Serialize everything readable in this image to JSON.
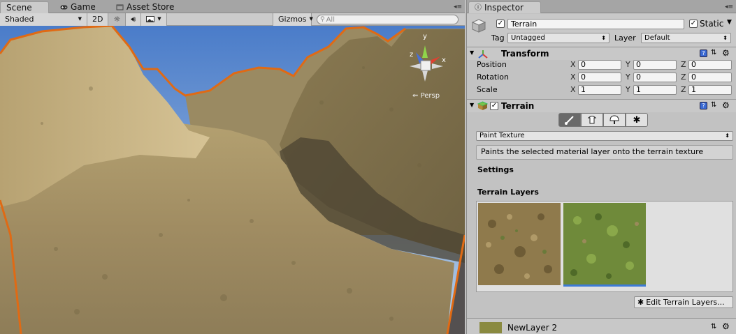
{
  "scene": {
    "tabs": [
      {
        "label": "Scene",
        "icon": "scene-icon",
        "active": true
      },
      {
        "label": "Game",
        "icon": "gamepad-icon",
        "active": false
      },
      {
        "label": "Asset Store",
        "icon": "store-icon",
        "active": false
      }
    ],
    "toolbar": {
      "shading_mode": "Shaded",
      "mode_2d": "2D",
      "gizmos_label": "Gizmos",
      "search_placeholder": "All"
    },
    "gizmo": {
      "axis_y": "y",
      "axis_z": "z",
      "axis_x": "x",
      "projection": "Persp"
    },
    "colors": {
      "selection_outline": "#e06a14",
      "sky_top": "#4a7cc9",
      "sky_bottom": "#b6cde6"
    }
  },
  "inspector": {
    "tab_label": "Inspector",
    "object": {
      "active": true,
      "name": "Terrain",
      "static_label": "Static",
      "static_checked": true,
      "tag_label": "Tag",
      "tag_value": "Untagged",
      "layer_label": "Layer",
      "layer_value": "Default"
    },
    "transform": {
      "title": "Transform",
      "position_label": "Position",
      "rotation_label": "Rotation",
      "scale_label": "Scale",
      "axis_x": "X",
      "axis_y": "Y",
      "axis_z": "Z",
      "position": {
        "x": "0",
        "y": "0",
        "z": "0"
      },
      "rotation": {
        "x": "0",
        "y": "0",
        "z": "0"
      },
      "scale": {
        "x": "1",
        "y": "1",
        "z": "1"
      }
    },
    "terrain": {
      "title": "Terrain",
      "enabled": true,
      "tools": [
        "paint-brush-icon",
        "raise-terrain-icon",
        "place-trees-icon",
        "settings-gear-icon"
      ],
      "selected_tool": 0,
      "paint_mode": "Paint Texture",
      "description": "Paints the selected material layer onto the terrain texture",
      "settings_label": "Settings",
      "layers_label": "Terrain Layers",
      "layers": [
        {
          "name": "dirt-layer",
          "color": "#8f7a4c",
          "selected": false
        },
        {
          "name": "grass-layer",
          "color": "#6f8a3a",
          "selected": true
        }
      ],
      "edit_layers_button": "Edit Terrain Layers...",
      "current_layer": "NewLayer 2"
    }
  }
}
